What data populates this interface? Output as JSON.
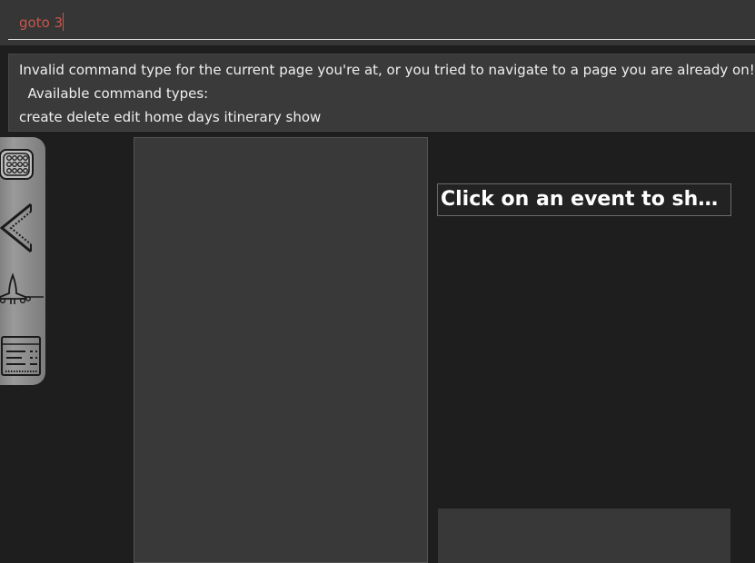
{
  "command_box": {
    "value": "goto 3"
  },
  "result_display": {
    "lines": [
      "Invalid command type for the current page you're at, or you tried to navigate to a page you are already on!",
      "  Available command types:",
      "create delete edit home days itinerary show"
    ]
  },
  "sidebar": {
    "items": [
      {
        "icon": "calendar-grid-icon"
      },
      {
        "icon": "back-arrow-icon"
      },
      {
        "icon": "airplane-icon"
      },
      {
        "icon": "itinerary-list-icon"
      }
    ]
  },
  "event_detail": {
    "title": "Click on an event to show d..."
  },
  "colors": {
    "background": "#1e1e1e",
    "command_text": "#c8564a",
    "panel": "#393939"
  }
}
